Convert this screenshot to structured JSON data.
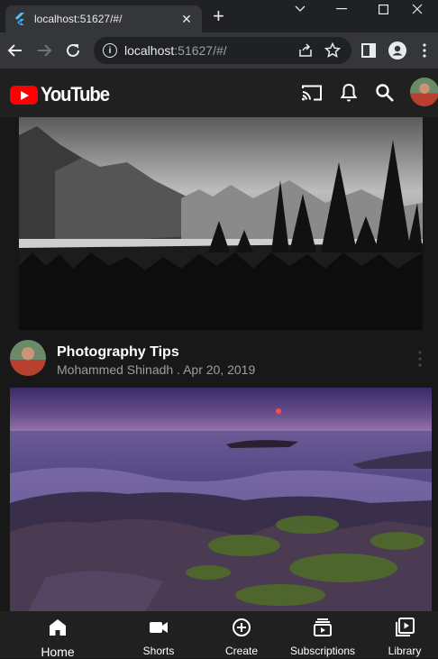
{
  "browser": {
    "tab_title": "localhost:51627/#/",
    "url_host": "localhost",
    "url_rest": ":51627/#/"
  },
  "app": {
    "logo_text": "YouTube",
    "icons": [
      "cast-icon",
      "bell-icon",
      "search-icon",
      "avatar"
    ]
  },
  "video": {
    "title": "Photography Tips",
    "channel": "Mohammed Shinadh",
    "date": "Apr 20, 2019",
    "meta": "Mohammed Shinadh . Apr 20, 2019"
  },
  "bottom_nav": [
    {
      "label": "Home",
      "icon": "home-icon"
    },
    {
      "label": "Shorts",
      "icon": "shorts-icon"
    },
    {
      "label": "Create",
      "icon": "create-icon"
    },
    {
      "label": "Subscriptions",
      "icon": "subscriptions-icon"
    },
    {
      "label": "Library",
      "icon": "library-icon"
    }
  ]
}
